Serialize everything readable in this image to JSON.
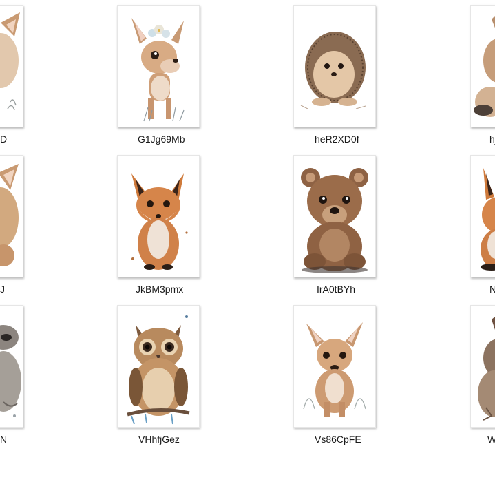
{
  "files": [
    {
      "name": "D",
      "icon": "baby-deer-icon"
    },
    {
      "name": "G1Jg69Mb",
      "icon": "baby-deer-with-flowers-icon"
    },
    {
      "name": "heR2XD0f",
      "icon": "hedgehog-icon"
    },
    {
      "name": "hj",
      "icon": "animal-icon"
    },
    {
      "name": "J",
      "icon": "baby-deer-icon"
    },
    {
      "name": "JkBM3pmx",
      "icon": "fox-icon"
    },
    {
      "name": "IrA0tBYh",
      "icon": "bear-cub-icon"
    },
    {
      "name": "N",
      "icon": "fox-icon"
    },
    {
      "name": "N",
      "icon": "raccoon-icon"
    },
    {
      "name": "VHhfjGez",
      "icon": "owl-icon"
    },
    {
      "name": "Vs86CpFE",
      "icon": "fawn-icon"
    },
    {
      "name": "W",
      "icon": "animal-icon"
    }
  ]
}
